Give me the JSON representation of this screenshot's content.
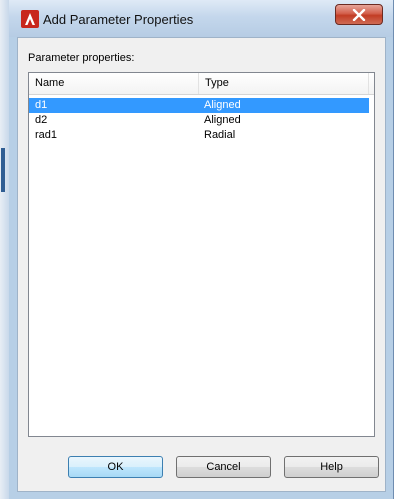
{
  "window": {
    "title": "Add Parameter Properties"
  },
  "group": {
    "label": "Parameter properties:"
  },
  "table": {
    "columns": [
      "Name",
      "Type"
    ],
    "rows": [
      {
        "name": "d1",
        "type": "Aligned",
        "selected": true
      },
      {
        "name": "d2",
        "type": "Aligned",
        "selected": false
      },
      {
        "name": "rad1",
        "type": "Radial",
        "selected": false
      }
    ]
  },
  "buttons": {
    "ok": "OK",
    "cancel": "Cancel",
    "help": "Help"
  },
  "colors": {
    "selection": "#3399ff",
    "close_button": "#c9503a"
  },
  "icons": {
    "app": "autocad-logo-icon",
    "close": "close-icon"
  }
}
